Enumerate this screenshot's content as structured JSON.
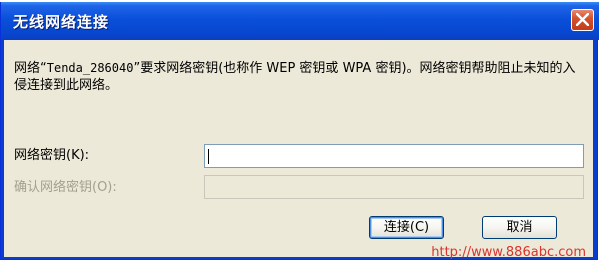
{
  "window": {
    "title": "无线网络连接",
    "close_icon": "close-icon"
  },
  "dialog": {
    "message_prefix": "网络“",
    "network_name": "Tenda_286040",
    "message_suffix": "”要求网络密钥(也称作 WEP 密钥或 WPA 密钥)。网络密钥帮助阻止未知的入侵连接到此网络。",
    "network_key_label": "网络密钥(K):",
    "network_key_value": "",
    "confirm_key_label": "确认网络密钥(O):",
    "confirm_key_value": "",
    "connect_button": "连接(C)",
    "cancel_button": "取消"
  },
  "watermark": "http://www.886abc.com",
  "colors": {
    "titlebar": "#0a4fd9",
    "client_bg": "#ece9d8",
    "close_button": "#d4532f",
    "watermark": "#d9342b"
  }
}
